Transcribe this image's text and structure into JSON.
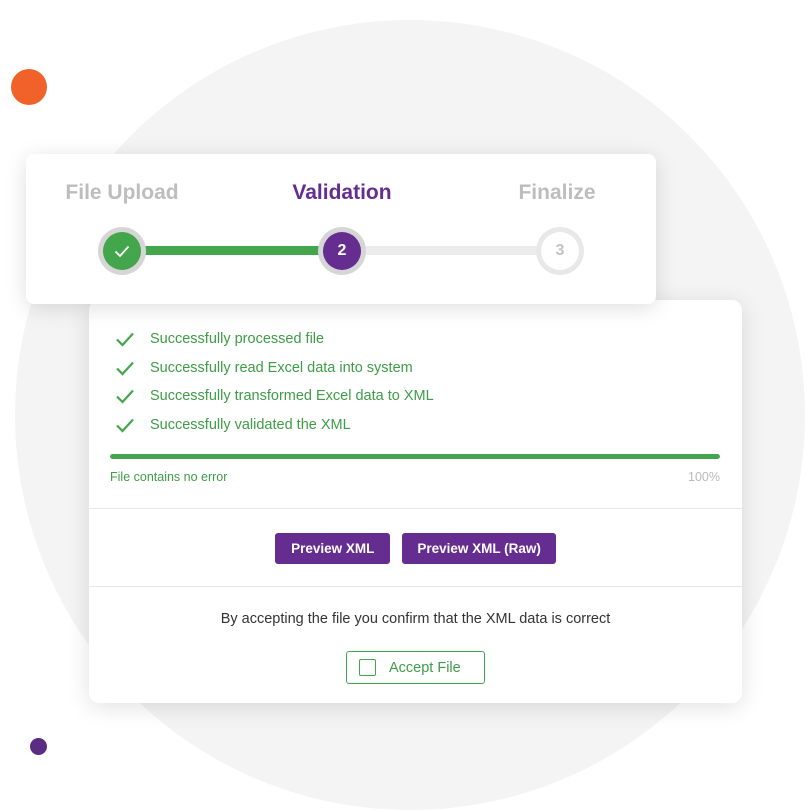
{
  "colors": {
    "accent_purple": "#662d91",
    "success_green": "#44a64c",
    "inactive_gray": "#bdbdbd",
    "orange_dot": "#f0622a"
  },
  "stepper": {
    "steps": [
      {
        "label": "File Upload",
        "number": "1",
        "state": "completed",
        "icon": "check-icon"
      },
      {
        "label": "Validation",
        "number": "2",
        "state": "active"
      },
      {
        "label": "Finalize",
        "number": "3",
        "state": "pending"
      }
    ],
    "progress_fraction": 0.5
  },
  "validation": {
    "checks": [
      {
        "text": "Successfully processed file",
        "icon": "check-icon"
      },
      {
        "text": "Successfully read Excel data into system",
        "icon": "check-icon"
      },
      {
        "text": "Successfully transformed Excel data to XML",
        "icon": "check-icon"
      },
      {
        "text": "Successfully validated the XML",
        "icon": "check-icon"
      }
    ],
    "progress_percent": 100,
    "status_text": "File contains no error",
    "percent_label": "100%"
  },
  "actions": {
    "preview_xml_label": "Preview XML",
    "preview_xml_raw_label": "Preview XML (Raw)"
  },
  "confirm": {
    "text": "By accepting the file you confirm that the XML data is correct",
    "accept_label": "Accept File",
    "accept_checked": false
  }
}
